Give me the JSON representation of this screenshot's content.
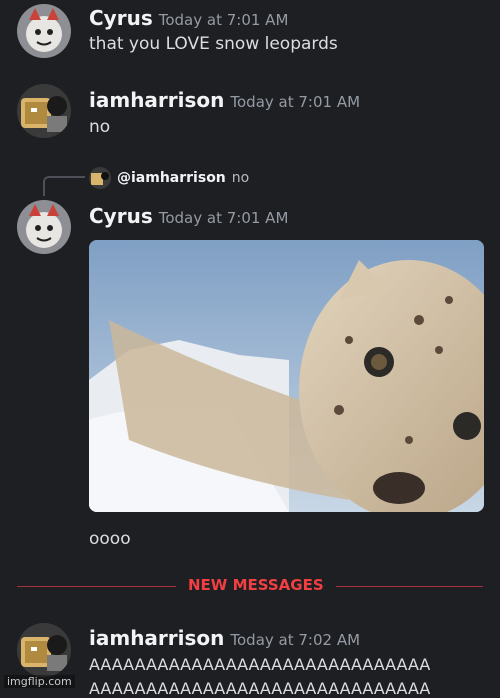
{
  "messages": [
    {
      "author": "Cyrus",
      "timestamp": "Today at 7:01 AM",
      "content": "that you LOVE snow leopards"
    },
    {
      "author": "iamharrison",
      "timestamp": "Today at 7:01 AM",
      "content": "no"
    },
    {
      "reply_to": {
        "user": "@iamharrison",
        "snippet": "no"
      },
      "author": "Cyrus",
      "timestamp": "Today at 7:01 AM",
      "attachment": "snow-leopard-image",
      "content": "oooo"
    },
    {
      "author": "iamharrison",
      "timestamp": "Today at 7:02 AM",
      "content_line1": "AAAAAAAAAAAAAAAAAAAAAAAAAAAAAA",
      "content_line2": "AAAAAAAAAAAAAAAAAAAAAAAAAAAAAA"
    }
  ],
  "divider": {
    "label": "NEW MESSAGES"
  },
  "watermark": "imgflip.com",
  "colors": {
    "background": "#1e1f22",
    "new_messages": "#f23f42",
    "username": "#f2f3f5",
    "timestamp": "#949ba4"
  }
}
